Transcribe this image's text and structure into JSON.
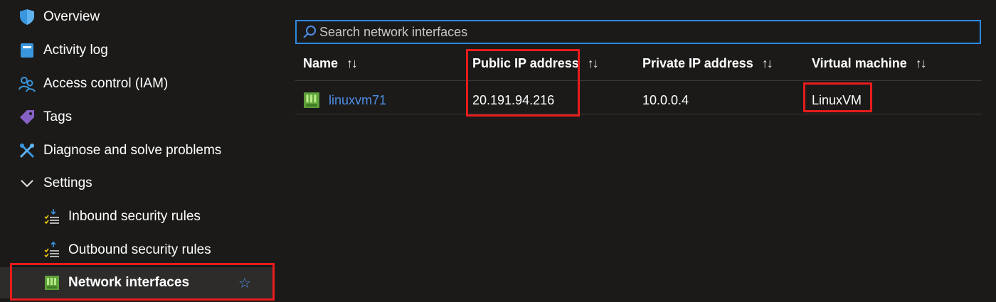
{
  "sidebar": {
    "items": [
      {
        "label": "Overview",
        "icon": "shield-icon"
      },
      {
        "label": "Activity log",
        "icon": "log-book-icon"
      },
      {
        "label": "Access control (IAM)",
        "icon": "people-icon"
      },
      {
        "label": "Tags",
        "icon": "tag-icon"
      },
      {
        "label": "Diagnose and solve problems",
        "icon": "wrench-icon"
      },
      {
        "label": "Settings",
        "icon": "chevron-down-icon"
      },
      {
        "label": "Inbound security rules",
        "icon": "inbound-rules-icon"
      },
      {
        "label": "Outbound security rules",
        "icon": "outbound-rules-icon"
      },
      {
        "label": "Network interfaces",
        "icon": "network-interface-icon"
      }
    ],
    "active_index": 8
  },
  "search": {
    "placeholder": "Search network interfaces",
    "value": ""
  },
  "table": {
    "columns": [
      "Name",
      "Public IP address",
      "Private IP address",
      "Virtual machine"
    ],
    "sort_glyph": "↑↓",
    "rows": [
      {
        "name": "linuxvm71",
        "public_ip": "20.191.94.216",
        "private_ip": "10.0.0.4",
        "vm": "LinuxVM"
      }
    ]
  },
  "colors": {
    "accent": "#2d8ae0",
    "highlight": "#e81c1c",
    "link": "#4f8fe6",
    "background": "#1b1a19"
  }
}
